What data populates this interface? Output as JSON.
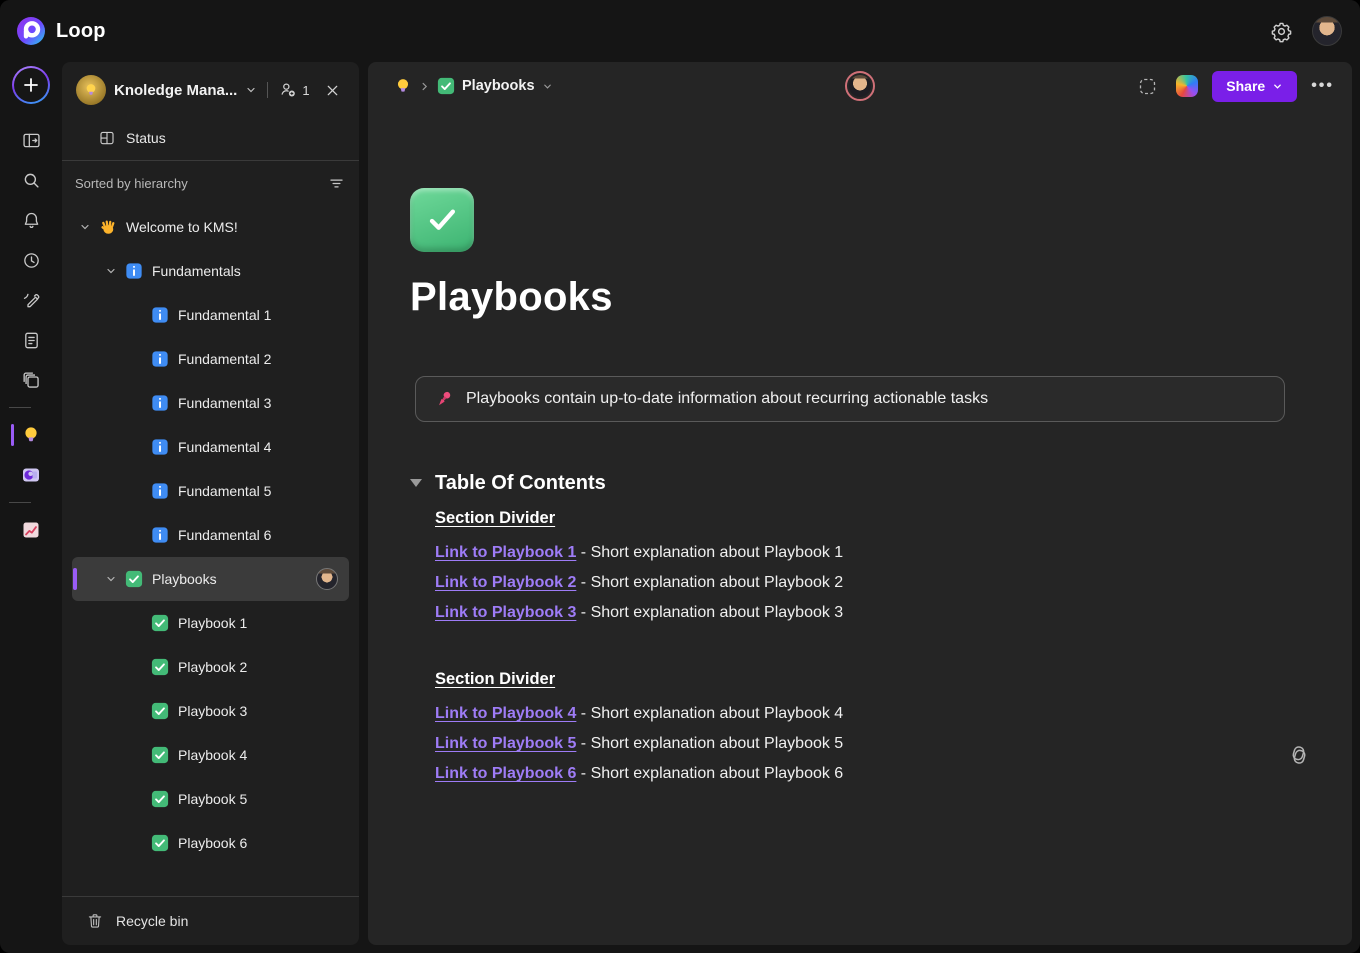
{
  "app": {
    "name": "Loop"
  },
  "topbar": {
    "settings_icon": "gear-icon",
    "account_icon": "user-avatar"
  },
  "rail": {
    "new_button_icon": "plus-icon",
    "items": [
      {
        "name": "panel-toggle",
        "icon": "panel-toggle-icon"
      },
      {
        "name": "search",
        "icon": "search-icon"
      },
      {
        "name": "notifications",
        "icon": "bell-icon"
      },
      {
        "name": "recent",
        "icon": "clock-icon"
      },
      {
        "name": "compose",
        "icon": "pen-icon"
      },
      {
        "name": "pages",
        "icon": "notes-icon"
      },
      {
        "name": "components",
        "icon": "layers-icon"
      },
      {
        "type": "divider"
      },
      {
        "name": "workspace-kms",
        "icon": "lightbulb-icon",
        "active": true
      },
      {
        "name": "workspace-loop",
        "icon": "loop-workspace-icon"
      },
      {
        "type": "divider"
      },
      {
        "name": "workspace-chart",
        "icon": "chart-icon"
      }
    ]
  },
  "sidebar": {
    "workspace": {
      "name": "Knoledge Mana...",
      "member_count": "1"
    },
    "status_label": "Status",
    "sorted_label": "Sorted by hierarchy",
    "tree": [
      {
        "label": "Welcome to KMS!",
        "icon": "wave-icon",
        "level": 0,
        "chevron": true
      },
      {
        "label": "Fundamentals",
        "icon": "info-icon",
        "level": 1,
        "chevron": true
      },
      {
        "label": "Fundamental 1",
        "icon": "info-icon",
        "level": 2
      },
      {
        "label": "Fundamental 2",
        "icon": "info-icon",
        "level": 2
      },
      {
        "label": "Fundamental 3",
        "icon": "info-icon",
        "level": 2
      },
      {
        "label": "Fundamental 4",
        "icon": "info-icon",
        "level": 2
      },
      {
        "label": "Fundamental 5",
        "icon": "info-icon",
        "level": 2
      },
      {
        "label": "Fundamental 6",
        "icon": "info-icon",
        "level": 2
      },
      {
        "label": "Playbooks",
        "icon": "check-icon",
        "level": 1,
        "chevron": true,
        "selected": true,
        "presence": true
      },
      {
        "label": "Playbook 1",
        "icon": "check-icon",
        "level": 2
      },
      {
        "label": "Playbook 2",
        "icon": "check-icon",
        "level": 2
      },
      {
        "label": "Playbook 3",
        "icon": "check-icon",
        "level": 2
      },
      {
        "label": "Playbook 4",
        "icon": "check-icon",
        "level": 2
      },
      {
        "label": "Playbook 5",
        "icon": "check-icon",
        "level": 2
      },
      {
        "label": "Playbook 6",
        "icon": "check-icon",
        "level": 2
      }
    ],
    "recycle_bin_label": "Recycle bin"
  },
  "main": {
    "breadcrumb": {
      "root_icon": "lightbulb-icon",
      "page_icon": "check-icon",
      "page_label": "Playbooks"
    },
    "actions": {
      "capture_icon": "dashed-select-icon",
      "copilot_icon": "copilot-icon",
      "share_label": "Share",
      "more_label": "•••"
    },
    "page": {
      "icon": "check-icon",
      "title": "Playbooks",
      "callout": {
        "icon": "pushpin-icon",
        "text": "Playbooks contain up-to-date information about recurring actionable tasks"
      },
      "toc": {
        "title": "Table Of Contents",
        "sections": [
          {
            "divider": "Section Divider",
            "entries": [
              {
                "link": "Link to Playbook 1",
                "text": " - Short explanation about Playbook 1"
              },
              {
                "link": "Link to Playbook 2",
                "text": " - Short explanation about Playbook 2"
              },
              {
                "link": "Link to Playbook 3",
                "text": " - Short explanation about Playbook 3"
              }
            ]
          },
          {
            "divider": "Section Divider",
            "entries": [
              {
                "link": "Link to Playbook 4",
                "text": " - Short explanation about Playbook 4"
              },
              {
                "link": "Link to Playbook 5",
                "text": " - Short explanation about Playbook 5"
              },
              {
                "link": "Link to Playbook 6",
                "text": " - Short explanation about Playbook 6"
              }
            ]
          }
        ]
      }
    }
  },
  "colors": {
    "accent": "#7a1fe8",
    "link": "#9e7cf6",
    "selection_bar": "#9a5cf5",
    "callout_border": "#5a5a5a"
  }
}
